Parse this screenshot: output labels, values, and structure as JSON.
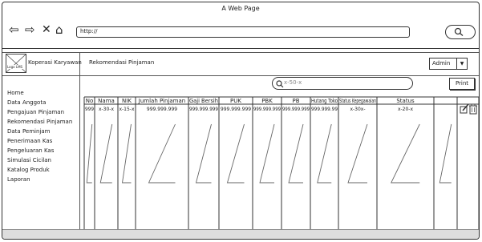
{
  "window": {
    "title": "A Web Page",
    "url": "http://"
  },
  "header": {
    "logo_text": "Logo LMS",
    "app_title": "Koperasi Karyawan",
    "page_title": "Rekomendasi Pinjaman",
    "user_select": "Admin"
  },
  "sidebar": {
    "items": [
      {
        "label": "Home"
      },
      {
        "label": "Data Anggota"
      },
      {
        "label": "Pengajuan Pinjaman"
      },
      {
        "label": "Rekomendasi Pinjaman"
      },
      {
        "label": "Data Peminjam"
      },
      {
        "label": "Penerimaan Kas"
      },
      {
        "label": "Pengeluaran Kas"
      },
      {
        "label": "Simulasi Cicilan"
      },
      {
        "label": "Katalog Produk"
      },
      {
        "label": "Laporan"
      }
    ]
  },
  "toolbar": {
    "search_value": "x-50-x",
    "print_label": "Print"
  },
  "table": {
    "columns": [
      {
        "label": "No",
        "value": "999"
      },
      {
        "label": "Nama",
        "value": "x-30-x"
      },
      {
        "label": "NIK",
        "value": "x-15-x"
      },
      {
        "label": "Jumlah Pinjaman",
        "value": "999.999.999"
      },
      {
        "label": "Gaji Bersih",
        "value": "999.999.999"
      },
      {
        "label": "PUK",
        "value": "999.999.999"
      },
      {
        "label": "PBK",
        "value": "999.999.999"
      },
      {
        "label": "PB",
        "value": "999.999.999"
      },
      {
        "label": "Hutang Toko",
        "value": "999.999.99"
      },
      {
        "label": "Status Kepegawaian",
        "value": "x-30x-"
      },
      {
        "label": "Status",
        "value": "x-20-x"
      },
      {
        "label": "",
        "value": ""
      }
    ]
  },
  "icons": {
    "back": "back-arrow-icon",
    "forward": "forward-arrow-icon",
    "stop": "close-icon",
    "home": "home-icon",
    "search": "search-icon",
    "edit": "edit-icon",
    "delete": "trash-icon"
  }
}
